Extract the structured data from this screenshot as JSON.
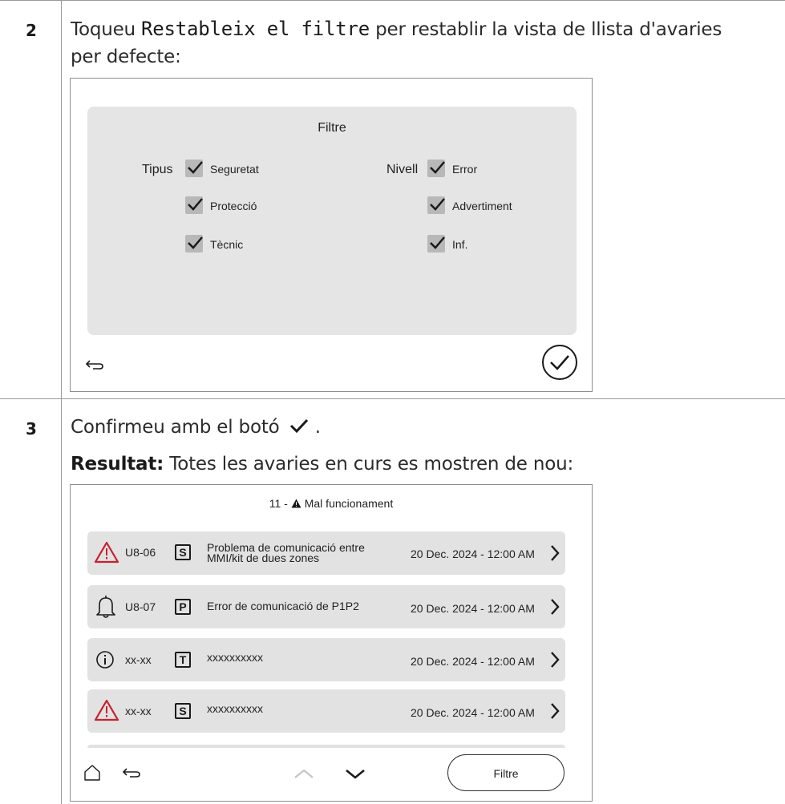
{
  "step2": {
    "number": "2",
    "text_before": "Toqueu ",
    "code": "Restableix el filtre",
    "text_after": " per restablir la vista de llista d'avaries",
    "line2": "per defecte:"
  },
  "filter_screen": {
    "title": "Filtre",
    "tipus_label": "Tipus",
    "nivell_label": "Nivell",
    "tipus_options": [
      "Seguretat",
      "Protecció",
      "Tècnic"
    ],
    "nivell_options": [
      "Error",
      "Advertiment",
      "Inf."
    ],
    "back_icon": "back-arrow-icon",
    "confirm_icon": "check-circle-icon"
  },
  "step3": {
    "number": "3",
    "text": "Confirmeu amb el botó",
    "text_end": ".",
    "result_label": "Resultat:",
    "result_text": " Totes les avaries en curs es mostren de nou:"
  },
  "fault_screen": {
    "title_prefix": "11 - ",
    "title_icon": "warning-triangle-icon",
    "title_text": "Mal funcionament",
    "rows": [
      {
        "icon": "warning-icon",
        "code": "U8-06",
        "badge": "S",
        "desc_line1": "Problema de comunicació entre",
        "desc_line2": "MMI/kit de dues zones",
        "date": "20 Dec. 2024 - 12:00 AM"
      },
      {
        "icon": "bell-icon",
        "code": "U8-07",
        "badge": "P",
        "desc_line1": "Error de comunicació de P1P2",
        "desc_line2": "",
        "date": "20 Dec. 2024 - 12:00 AM"
      },
      {
        "icon": "info-icon",
        "code": "xx-xx",
        "badge": "T",
        "desc_line1": "xxxxxxxxxx",
        "desc_line2": "",
        "date": "20 Dec. 2024 - 12:00 AM"
      },
      {
        "icon": "warning-icon",
        "code": "xx-xx",
        "badge": "S",
        "desc_line1": "xxxxxxxxxx",
        "desc_line2": "",
        "date": "20 Dec. 2024 - 12:00 AM"
      }
    ],
    "filter_button": "Filtre",
    "colors": {
      "warning": "#c8202f",
      "row_bg": "#e2e2e2"
    }
  }
}
